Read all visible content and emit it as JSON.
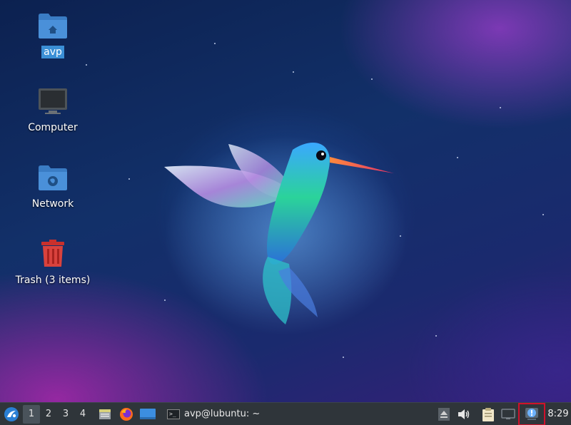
{
  "desktop": {
    "icons": [
      {
        "label": "avp",
        "icon": "home-folder-icon",
        "selected": true
      },
      {
        "label": "Computer",
        "icon": "computer-icon"
      },
      {
        "label": "Network",
        "icon": "network-folder-icon"
      },
      {
        "label": "Trash (3 items)",
        "icon": "trash-icon"
      }
    ]
  },
  "taskbar": {
    "start_icon": "lubuntu-logo-icon",
    "workspaces": [
      "1",
      "2",
      "3",
      "4"
    ],
    "active_workspace": "1",
    "launchers": [
      "file-manager-icon",
      "firefox-icon",
      "show-desktop-icon"
    ],
    "tasks": [
      {
        "label": "avp@lubuntu: ~",
        "icon": "terminal-icon"
      }
    ],
    "tray": [
      "eject-icon",
      "volume-icon",
      "clipboard-icon",
      "network-monitor-icon",
      "update-notifier-icon"
    ],
    "clock": "8:29"
  },
  "colors": {
    "folder_blue": "#4a90d9",
    "selection": "#3b8fd6",
    "trash_red": "#c9302c",
    "taskbar_bg": "#2f353a",
    "highlight_box": "#d0112b"
  }
}
